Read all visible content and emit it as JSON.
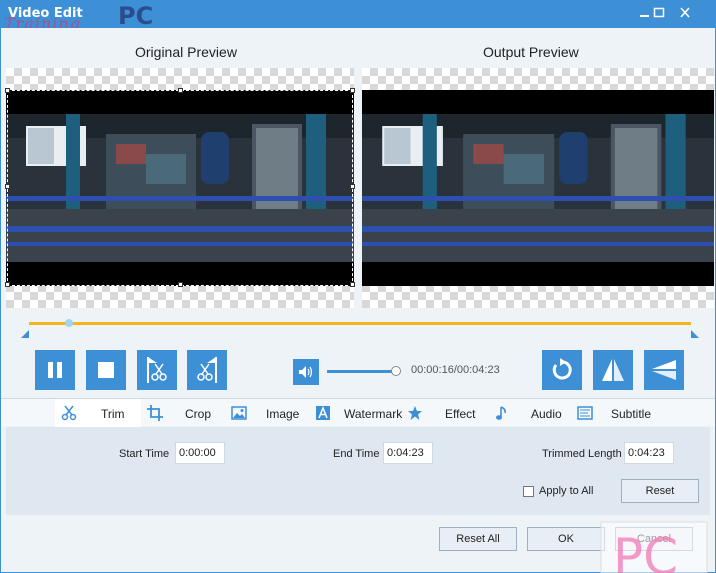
{
  "window": {
    "title": "Video Edit",
    "watermark_text_1": "Training",
    "watermark_text_2": "PC"
  },
  "preview": {
    "original_label": "Original Preview",
    "output_label": "Output Preview"
  },
  "player": {
    "timecode": "00:00:16/00:04:23",
    "playback_position": 0.06,
    "volume": 0.95,
    "controls": [
      "pause-icon",
      "stop-icon",
      "cut-start-icon",
      "cut-end-icon",
      "rotate-icon",
      "flip-horizontal-icon",
      "flip-vertical-icon"
    ],
    "accent_color": "#3d8fd6",
    "timeline_color": "#f2b619"
  },
  "tabs": [
    {
      "label": "Trim",
      "icon": "scissors-icon",
      "active": true
    },
    {
      "label": "Crop",
      "icon": "crop-icon",
      "active": false
    },
    {
      "label": "Image",
      "icon": "image-icon",
      "active": false
    },
    {
      "label": "Watermark",
      "icon": "watermark-icon",
      "active": false
    },
    {
      "label": "Effect",
      "icon": "star-icon",
      "active": false
    },
    {
      "label": "Audio",
      "icon": "music-note-icon",
      "active": false
    },
    {
      "label": "Subtitle",
      "icon": "subtitle-icon",
      "active": false
    }
  ],
  "trim": {
    "start_time_label": "Start Time",
    "start_time_value": "0:00:00",
    "end_time_label": "End Time",
    "end_time_value": "0:04:23",
    "trimmed_length_label": "Trimmed Length",
    "trimmed_length_value": "0:04:23",
    "apply_to_all_label": "Apply to All",
    "apply_to_all_checked": false,
    "reset_label": "Reset"
  },
  "footer": {
    "reset_all_label": "Reset All",
    "ok_label": "OK",
    "cancel_label": "Cancel"
  },
  "corner_watermark": {
    "text": "PC"
  }
}
